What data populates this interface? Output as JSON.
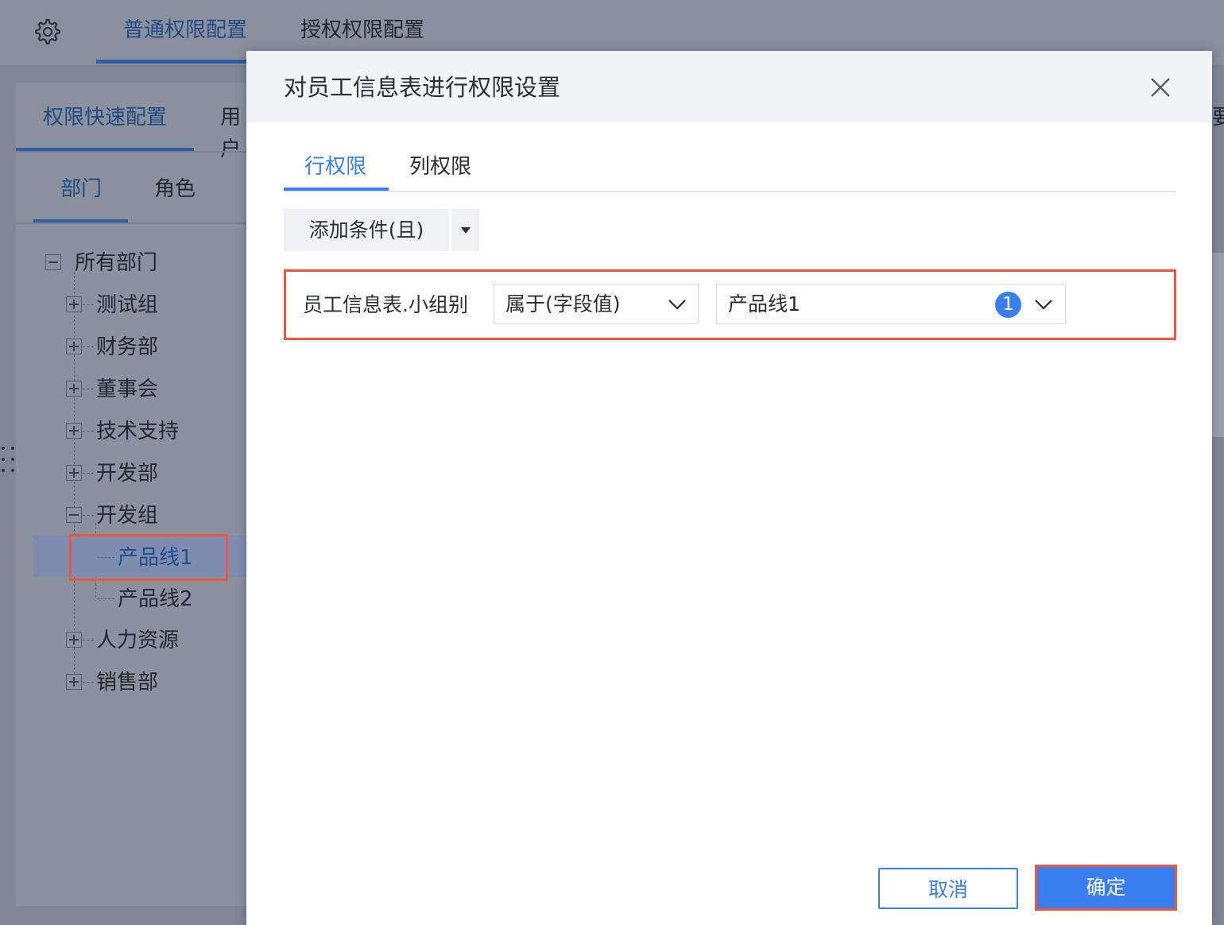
{
  "topbar": {
    "gear_icon": "gear-icon",
    "tabs": [
      {
        "label": "普通权限配置",
        "active": true
      },
      {
        "label": "授权权限配置",
        "active": false
      }
    ]
  },
  "side": {
    "tabs": [
      {
        "label": "权限快速配置",
        "active": true
      },
      {
        "label": "用户"
      }
    ],
    "subtabs": [
      {
        "label": "部门",
        "active": true
      },
      {
        "label": "角色"
      }
    ],
    "tree": {
      "root": "所有部门",
      "items": [
        "测试组",
        "财务部",
        "董事会",
        "技术支持",
        "开发部",
        "开发组"
      ],
      "children": [
        "产品线1",
        "产品线2"
      ],
      "items_after": [
        "人力资源",
        "销售部"
      ],
      "selected": "产品线1"
    }
  },
  "right_edge_text": "要",
  "modal": {
    "title": "对员工信息表进行权限设置",
    "tabs": [
      {
        "label": "行权限",
        "active": true
      },
      {
        "label": "列权限"
      }
    ],
    "add_condition_label": "添加条件(且)",
    "condition": {
      "field": "员工信息表.小组别",
      "operator": "属于(字段值)",
      "value": "产品线1",
      "count": "1"
    },
    "cancel_label": "取消",
    "ok_label": "确定"
  },
  "colors": {
    "primary": "#3a7ff0",
    "highlight": "#f0563c",
    "overlay": "#8a909c"
  }
}
